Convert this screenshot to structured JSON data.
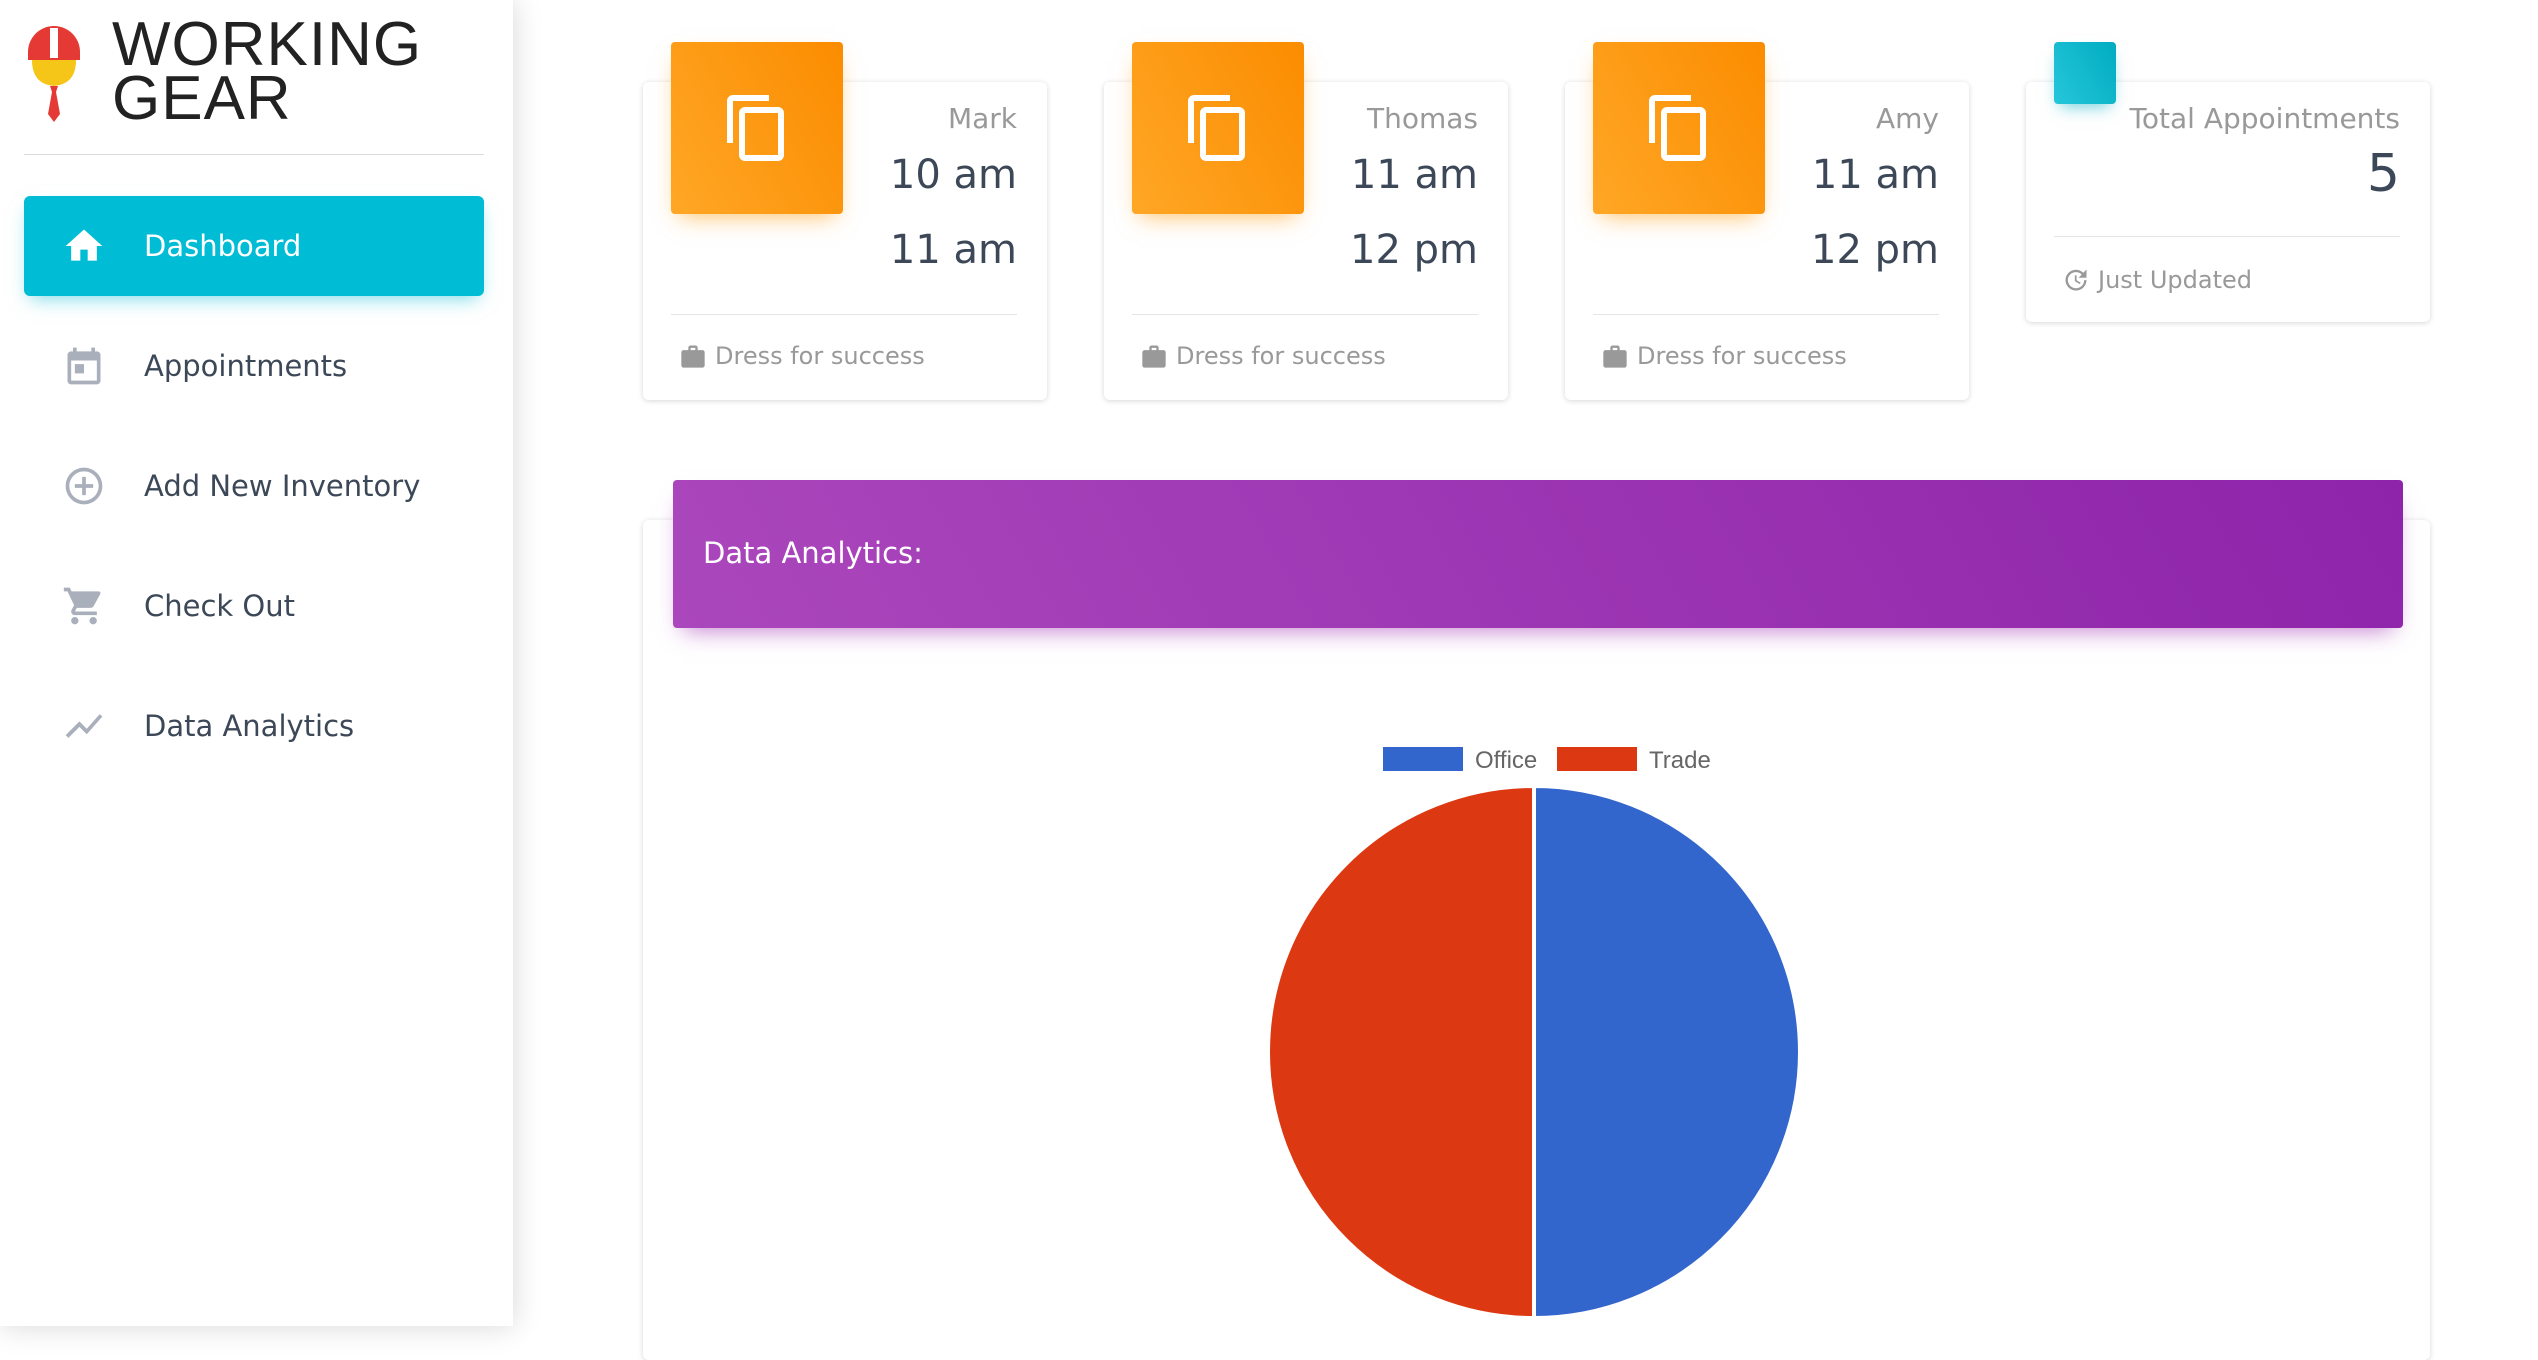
{
  "brand": {
    "line1": "WORKING",
    "line2": "GEAR"
  },
  "sidebar": {
    "items": [
      {
        "label": "Dashboard",
        "icon": "home-icon",
        "active": true
      },
      {
        "label": "Appointments",
        "icon": "calendar-icon",
        "active": false
      },
      {
        "label": "Add New Inventory",
        "icon": "add-circle-icon",
        "active": false
      },
      {
        "label": "Check Out",
        "icon": "cart-icon",
        "active": false
      },
      {
        "label": "Data Analytics",
        "icon": "trending-icon",
        "active": false
      }
    ]
  },
  "appointments": [
    {
      "name": "Mark",
      "start": "10 am",
      "end": "11 am",
      "footer": "Dress for success",
      "icon": "copy-icon"
    },
    {
      "name": "Thomas",
      "start": "11 am",
      "end": "12 pm",
      "footer": "Dress for success",
      "icon": "copy-icon"
    },
    {
      "name": "Amy",
      "start": "11 am",
      "end": "12 pm",
      "footer": "Dress for success",
      "icon": "copy-icon"
    }
  ],
  "total": {
    "label": "Total Appointments",
    "value": "5",
    "footer": "Just Updated"
  },
  "analytics": {
    "title": "Data Analytics:"
  },
  "colors": {
    "sidebar_active": "#00bcd4",
    "card_icon": "#fb8c00",
    "total_icon": "#00acc1",
    "analytics_header": "#9c27b0"
  },
  "chart_data": {
    "type": "pie",
    "categories": [
      "Office",
      "Trade"
    ],
    "values": [
      1,
      1
    ],
    "colors": [
      "#3366cc",
      "#dc3912"
    ],
    "legend": "top"
  }
}
